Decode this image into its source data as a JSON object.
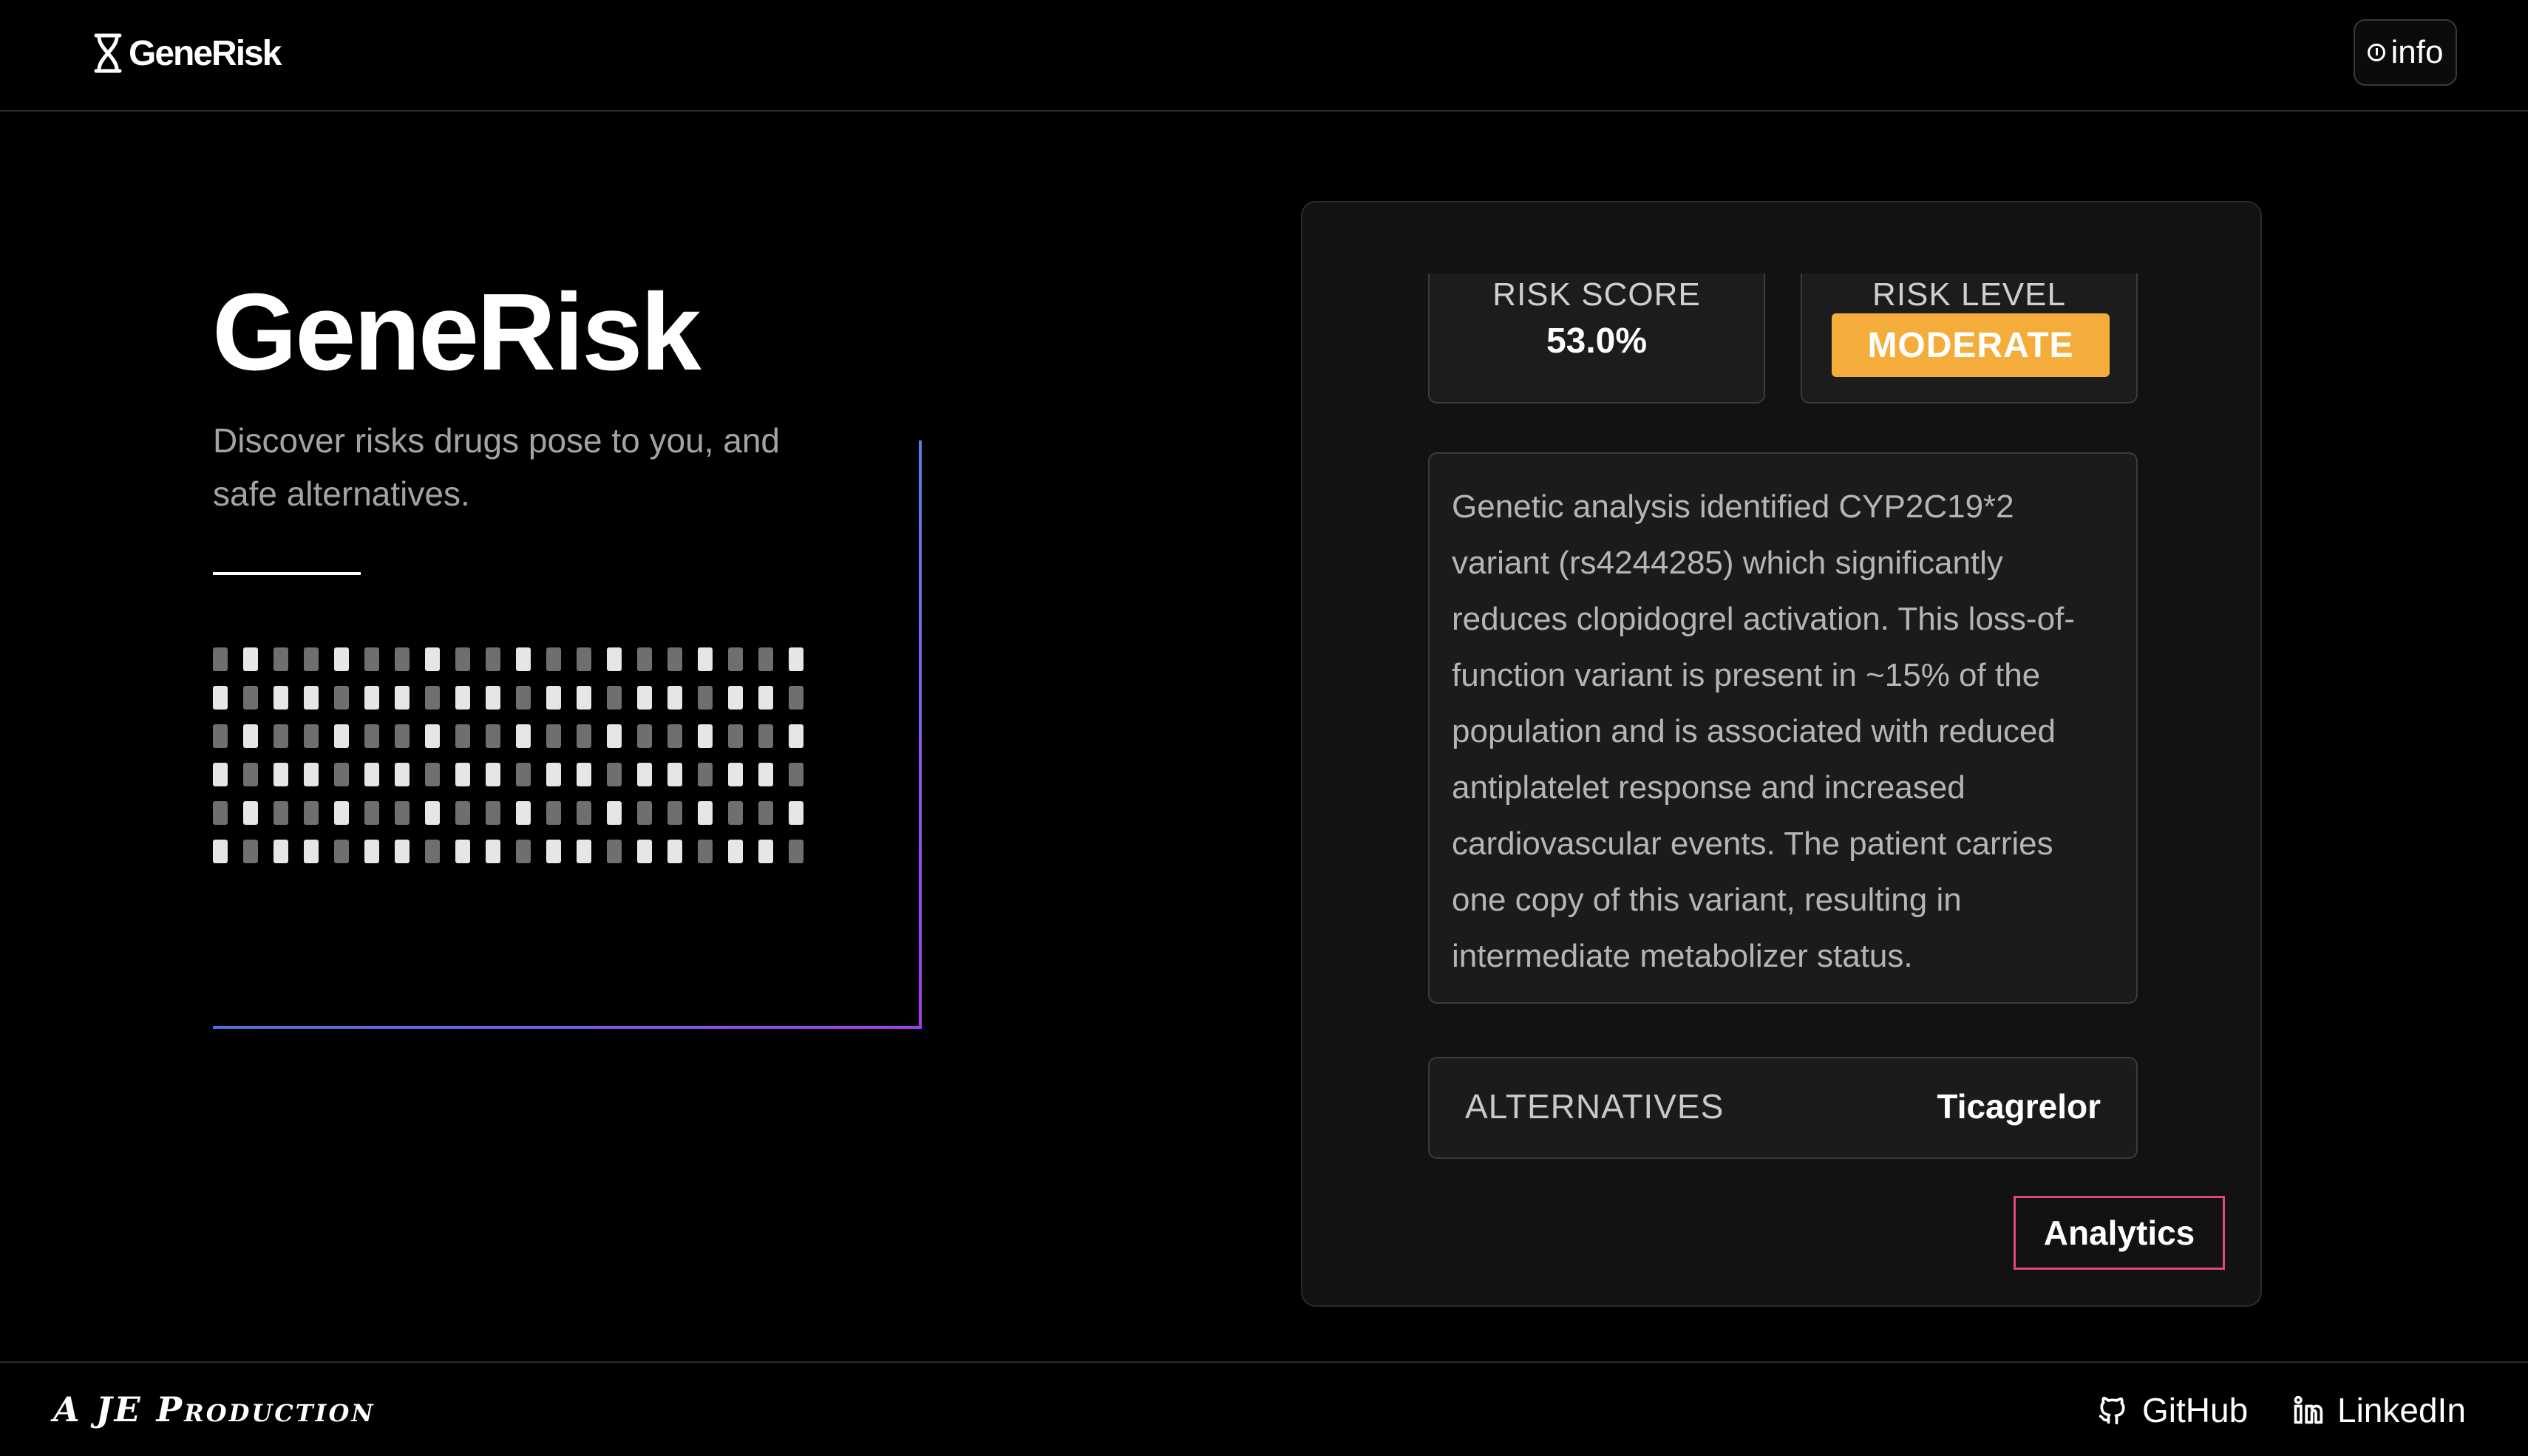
{
  "header": {
    "brand": "GeneRisk",
    "info_label": "info"
  },
  "hero": {
    "title": "GeneRisk",
    "subtitle": "Discover risks drugs pose to you, and safe alternatives."
  },
  "result": {
    "risk_score_label": "RISK SCORE",
    "risk_score_value": "53.0%",
    "risk_level_label": "RISK LEVEL",
    "risk_level_value": "MODERATE",
    "analysis": "Genetic analysis identified CYP2C19*2 variant (rs4244285) which significantly reduces clopidogrel activation. This loss-of-function variant is present in ~15% of the population and is associated with reduced antiplatelet response and increased cardiovascular events. The patient carries one copy of this variant, resulting in intermediate metabolizer status.",
    "alternatives_label": "ALTERNATIVES",
    "alternatives_value": "Ticagrelor",
    "analytics_label": "Analytics"
  },
  "footer": {
    "credit": "A JE Production",
    "github_label": "GitHub",
    "linkedin_label": "LinkedIn"
  },
  "colors": {
    "background": "#000000",
    "card": "#121212",
    "moderate_badge": "#f4ad3a",
    "analytics_border": "#e2487f",
    "accent_gradient_start": "#4a74e0",
    "accent_gradient_end": "#a43cf0"
  },
  "icons": {
    "logo": "dna-icon",
    "info": "info-icon",
    "github": "github-icon",
    "linkedin": "linkedin-icon"
  }
}
